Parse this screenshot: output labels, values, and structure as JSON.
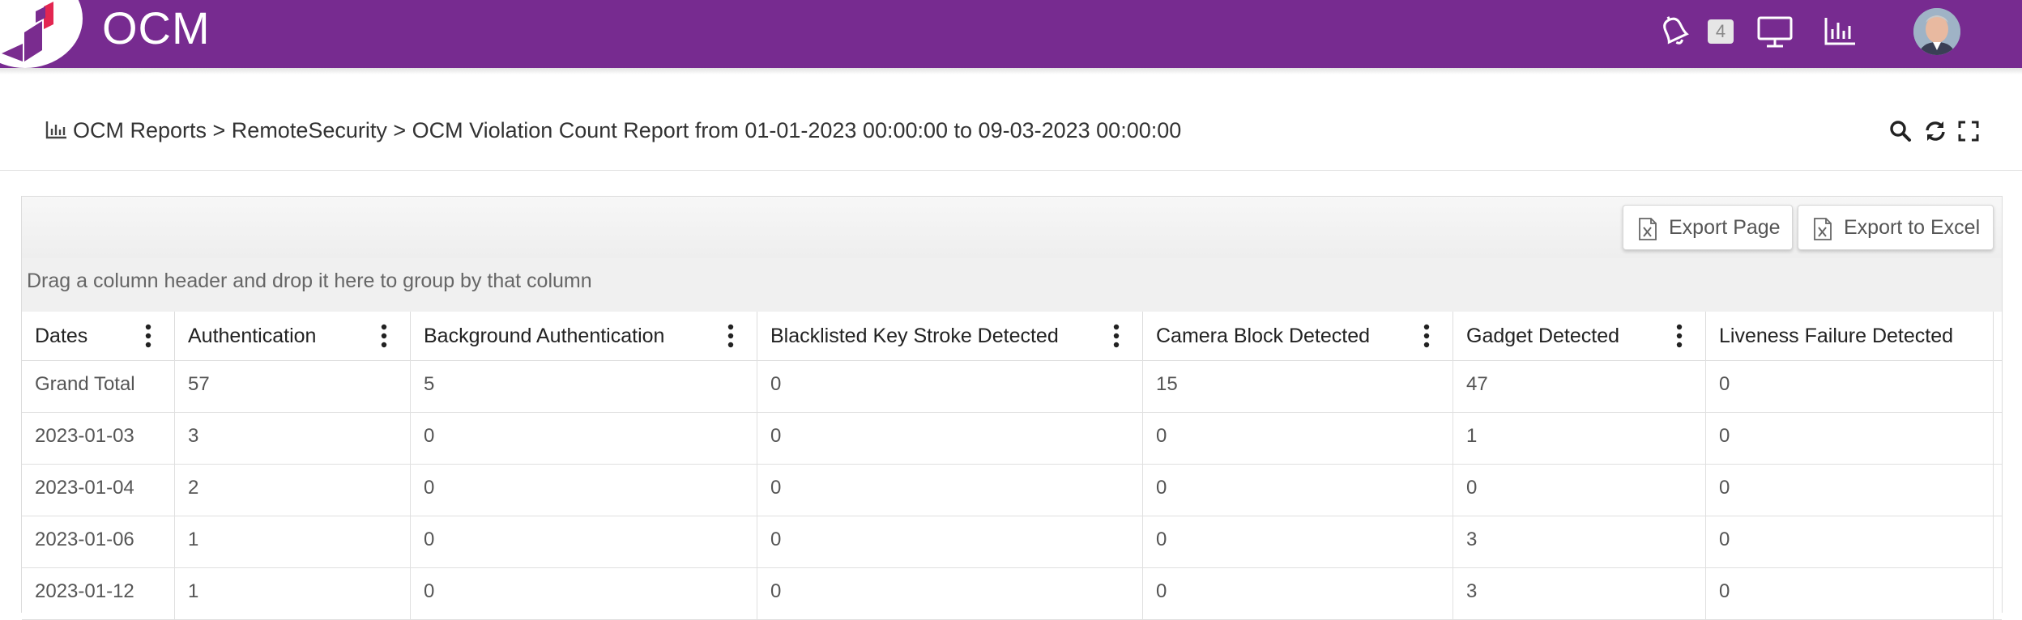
{
  "app": {
    "title": "OCM"
  },
  "header": {
    "notification_count": "4",
    "icons": [
      "notification-icon",
      "monitor-icon",
      "chart-icon"
    ],
    "colors": {
      "brand": "#772b90"
    }
  },
  "breadcrumb": {
    "text": "OCM Reports > RemoteSecurity > OCM Violation Count Report from 01-01-2023 00:00:00 to 09-03-2023 00:00:00"
  },
  "toolbar": {
    "export_page_label": "Export Page",
    "export_excel_label": "Export to Excel"
  },
  "grid": {
    "group_hint": "Drag a column header and drop it here to group by that column",
    "columns": [
      "Dates",
      "Authentication",
      "Background Authentication",
      "Blacklisted Key Stroke Detected",
      "Camera Block Detected",
      "Gadget Detected",
      "Liveness Failure Detected"
    ],
    "rows": [
      [
        "Grand Total",
        "57",
        "5",
        "0",
        "15",
        "47",
        "0"
      ],
      [
        "2023-01-03",
        "3",
        "0",
        "0",
        "0",
        "1",
        "0"
      ],
      [
        "2023-01-04",
        "2",
        "0",
        "0",
        "0",
        "0",
        "0"
      ],
      [
        "2023-01-06",
        "1",
        "0",
        "0",
        "0",
        "3",
        "0"
      ],
      [
        "2023-01-12",
        "1",
        "0",
        "0",
        "0",
        "3",
        "0"
      ]
    ]
  }
}
